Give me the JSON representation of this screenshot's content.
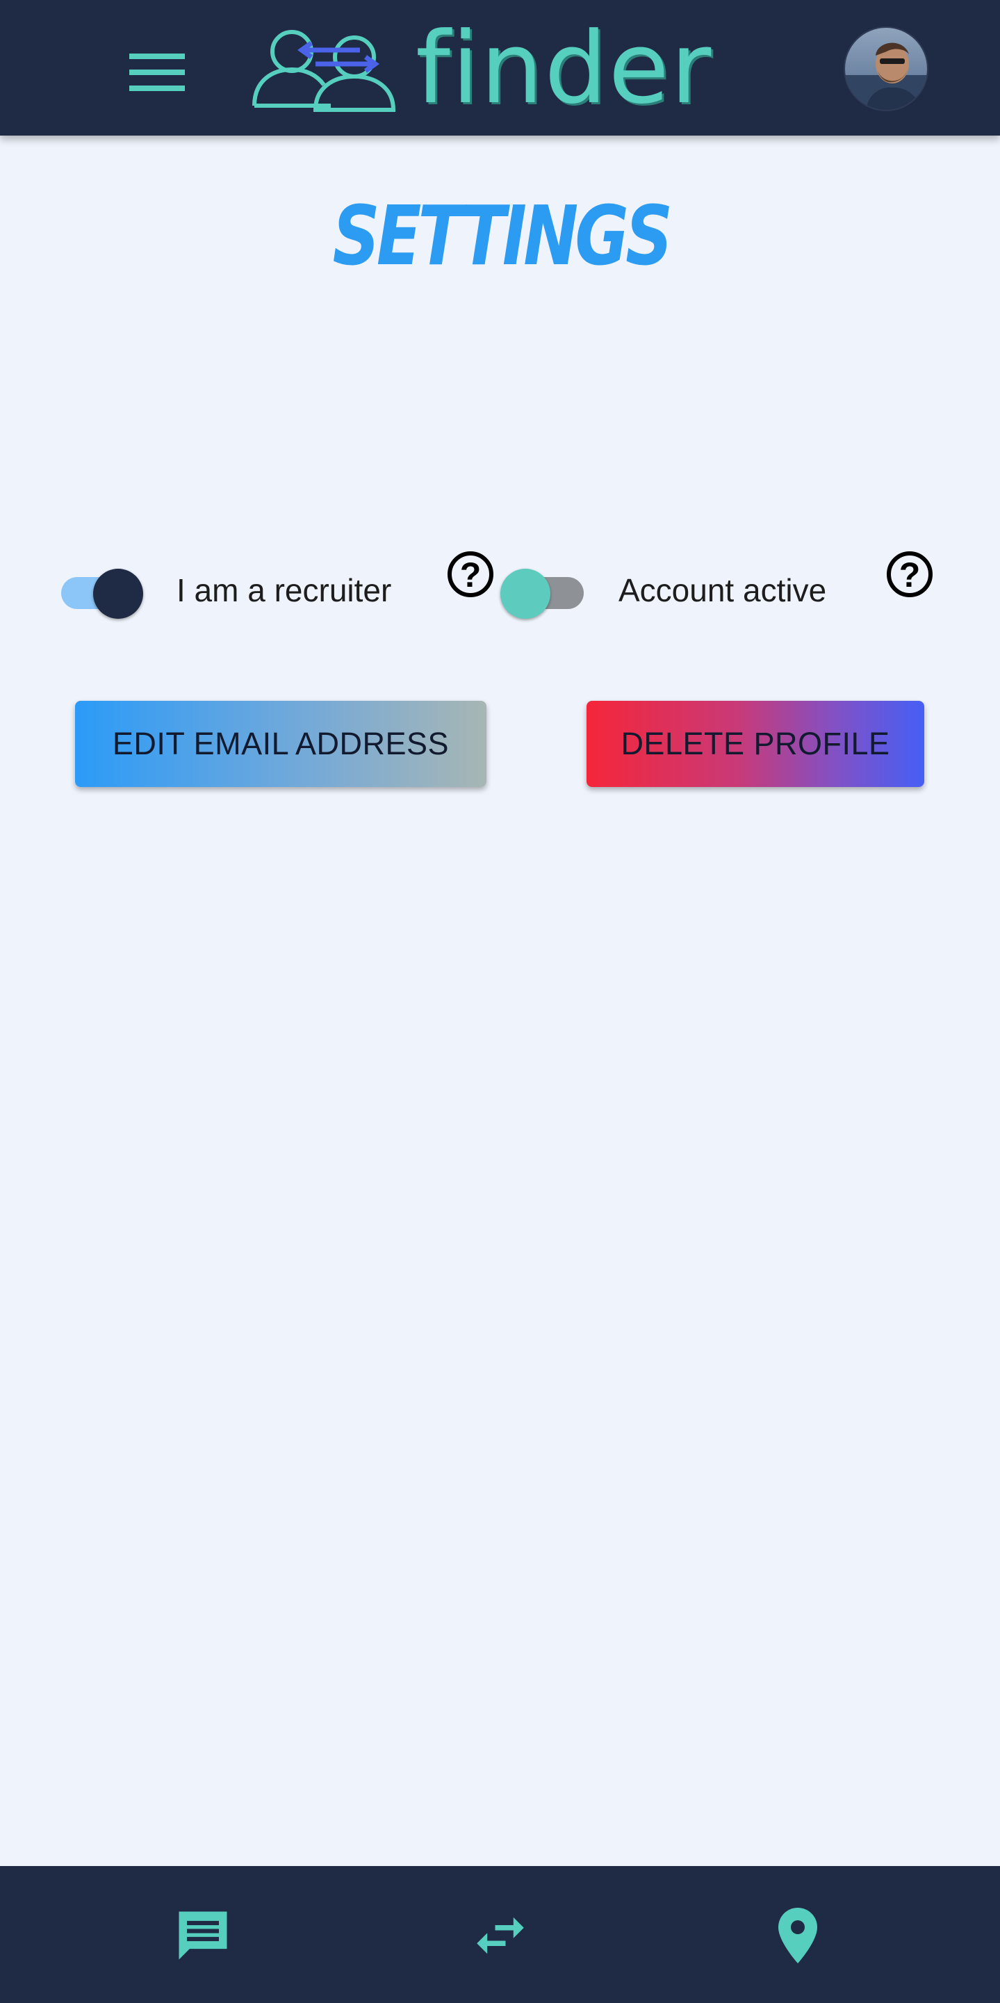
{
  "header": {
    "brand": "finder",
    "menu_icon": "menu-icon",
    "logo_icon": "people-swap-icon",
    "avatar": "user-avatar"
  },
  "page": {
    "title": "SETTINGS"
  },
  "settings": {
    "recruiter": {
      "label": "I am a recruiter",
      "checked": true,
      "help_icon": "help-circle-icon"
    },
    "account_active": {
      "label": "Account active",
      "checked": false,
      "help_icon": "help-circle-icon"
    }
  },
  "actions": {
    "edit_email_label": "EDIT EMAIL ADDRESS",
    "delete_profile_label": "DELETE PROFILE"
  },
  "bottom_nav": {
    "items": [
      {
        "icon": "chat-icon"
      },
      {
        "icon": "swap-arrows-icon"
      },
      {
        "icon": "location-pin-icon"
      }
    ]
  },
  "colors": {
    "navy": "#1f2b44",
    "teal": "#57cfbf",
    "blue": "#2c9bf2",
    "background": "#eff4fc"
  }
}
